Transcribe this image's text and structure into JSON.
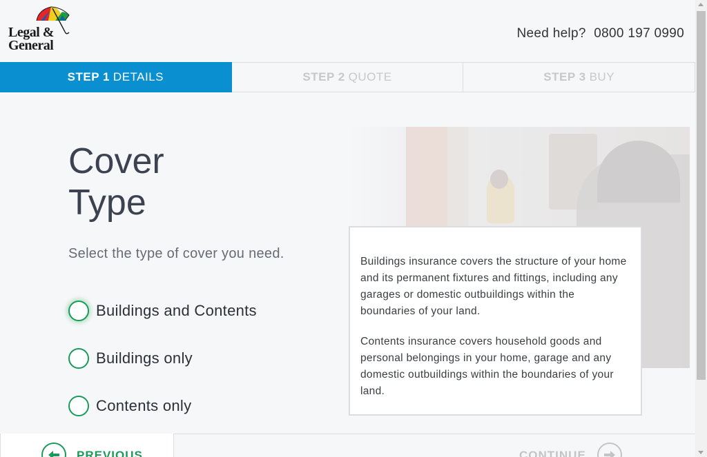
{
  "header": {
    "logo_line1": "Legal &",
    "logo_line2": "General",
    "help_label": "Need help?",
    "phone": "0800 197 0990"
  },
  "steps": [
    {
      "num": "STEP 1",
      "label": "DETAILS",
      "active": true
    },
    {
      "num": "STEP 2",
      "label": "QUOTE",
      "active": false
    },
    {
      "num": "STEP 3",
      "label": "BUY",
      "active": false
    }
  ],
  "main": {
    "title_line1": "Cover",
    "title_line2": "Type",
    "subtitle": "Select the type of cover you need.",
    "options": [
      {
        "label": "Buildings and Contents"
      },
      {
        "label": "Buildings only"
      },
      {
        "label": "Contents only"
      }
    ]
  },
  "info": {
    "buildings_text": "Buildings insurance covers the structure of your home and its permanent fixtures and fittings, including any garages or domestic outbuildings within the boundaries of your land.",
    "contents_text": "Contents insurance covers household goods and personal belongings in your home, garage and any domestic outbuildings within the boundaries of your land."
  },
  "footer": {
    "previous_label": "PREVIOUS",
    "continue_label": "CONTINUE"
  },
  "colors": {
    "accent_blue": "#0a8fd1",
    "radio_green": "#1a9a5a"
  },
  "icons": {
    "logo": "umbrella-icon",
    "previous": "arrow-left-icon",
    "continue": "arrow-right-icon"
  }
}
